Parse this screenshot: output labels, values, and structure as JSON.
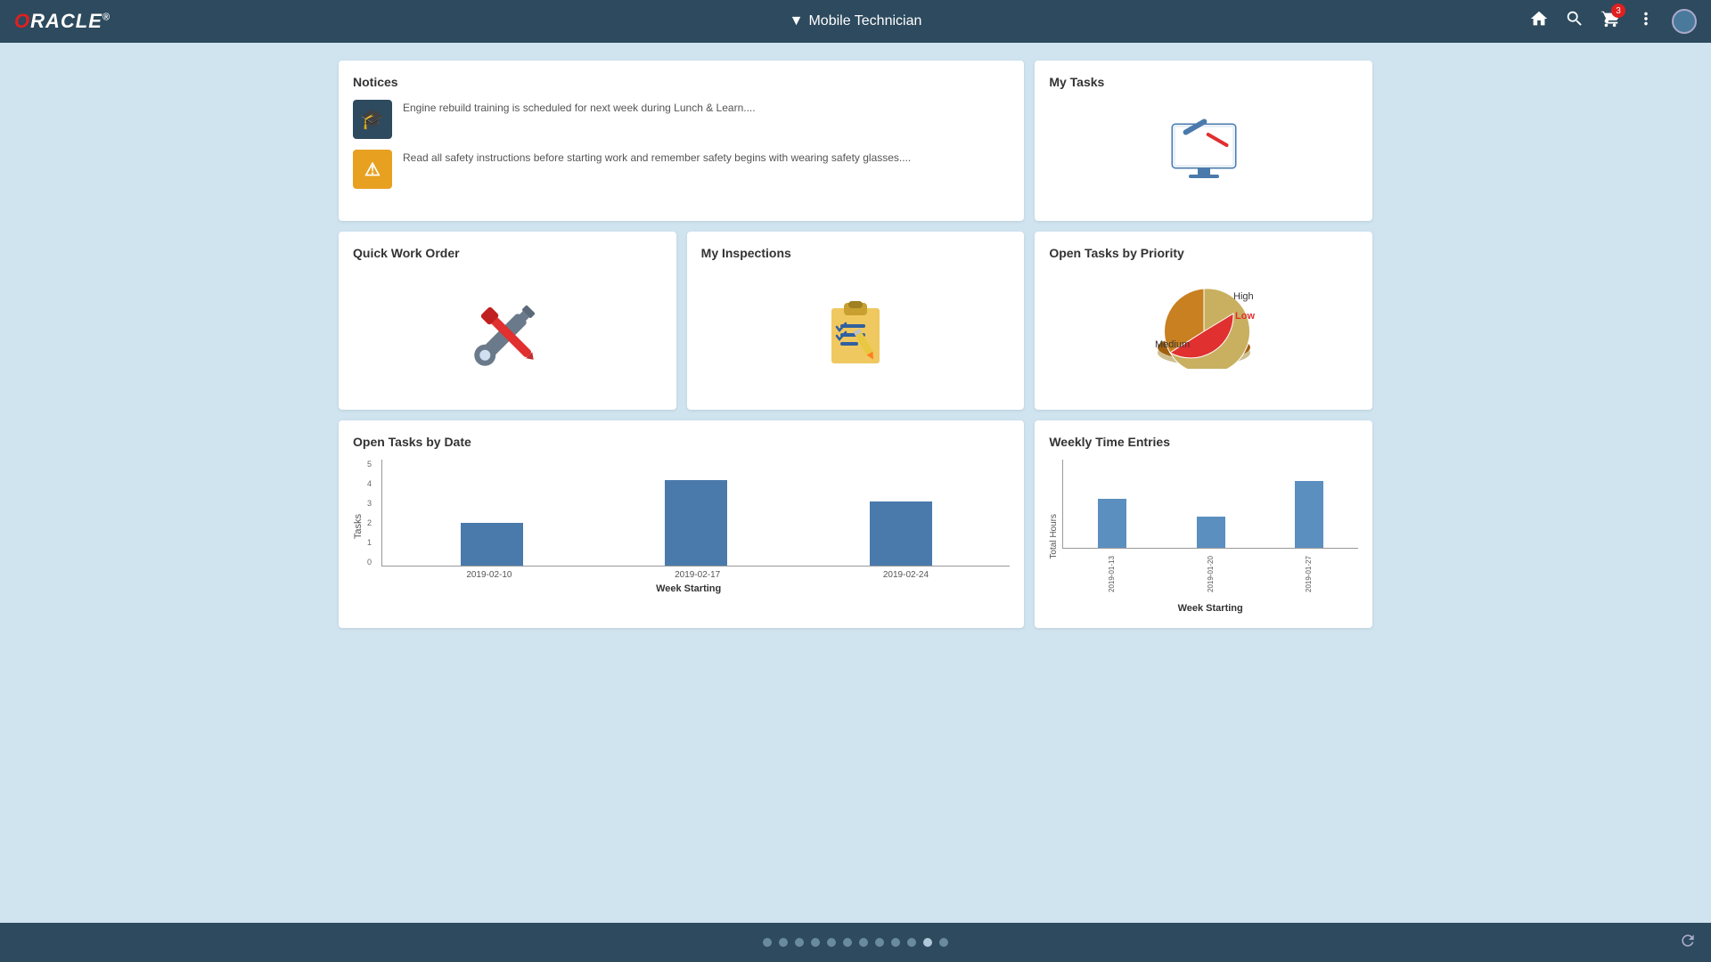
{
  "header": {
    "logo": "ORACLE",
    "title": "Mobile Technician",
    "title_arrow": "▼",
    "cart_badge": "3"
  },
  "notices": {
    "title": "Notices",
    "items": [
      {
        "icon": "🎓",
        "type": "education",
        "text": "Engine rebuild training is scheduled for next week during Lunch & Learn...."
      },
      {
        "icon": "⚠",
        "type": "warning",
        "text": "Read all safety instructions before starting work and remember safety begins with wearing safety glasses...."
      }
    ]
  },
  "my_tasks": {
    "title": "My Tasks"
  },
  "quick_work_order": {
    "title": "Quick Work Order"
  },
  "my_inspections": {
    "title": "My Inspections"
  },
  "open_tasks_priority": {
    "title": "Open Tasks by Priority",
    "segments": [
      {
        "label": "High",
        "color": "#c8b060",
        "value": 50
      },
      {
        "label": "Low",
        "color": "#e03030",
        "value": 20
      },
      {
        "label": "Medium",
        "color": "#c88020",
        "value": 30
      }
    ]
  },
  "open_tasks_date": {
    "title": "Open Tasks by Date",
    "y_label": "Tasks",
    "x_label": "Week Starting",
    "y_ticks": [
      "0",
      "1",
      "2",
      "3",
      "4",
      "5"
    ],
    "bars": [
      {
        "label": "2019-02-10",
        "value": 2,
        "height_pct": 40
      },
      {
        "label": "2019-02-17",
        "value": 4,
        "height_pct": 80
      },
      {
        "label": "2019-02-24",
        "value": 3,
        "height_pct": 60
      }
    ]
  },
  "weekly_time": {
    "title": "Weekly Time Entries",
    "y_label": "Total Hours",
    "x_label": "Week Starting",
    "bars": [
      {
        "label": "2019-01-13",
        "height_pct": 55
      },
      {
        "label": "2019-01-20",
        "height_pct": 35
      },
      {
        "label": "2019-01-27",
        "height_pct": 75
      }
    ]
  },
  "footer": {
    "dots": [
      0,
      1,
      2,
      3,
      4,
      5,
      6,
      7,
      8,
      9,
      10,
      11
    ],
    "active_dot": 10
  }
}
